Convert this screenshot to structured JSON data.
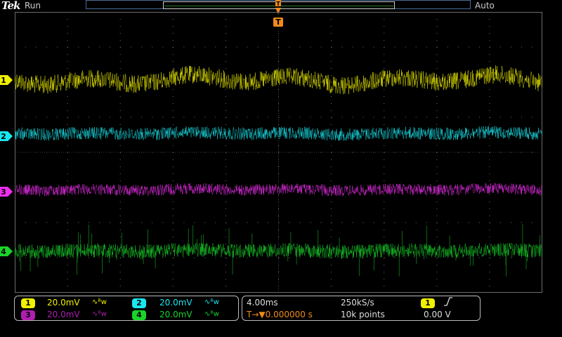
{
  "header": {
    "brand": "Tek",
    "acq_state": "Run",
    "trigger_mode": "Auto",
    "trigger_marker": "T"
  },
  "colors": {
    "ch1": "#f0f000",
    "ch2": "#19e6ef",
    "ch3": "#f02ef0",
    "ch4": "#19d42a",
    "trigger": "#f08a1c",
    "graticule": "#6b6b6b"
  },
  "channels": [
    {
      "id": "1",
      "scale": "20.0mV",
      "bw": "∿ᴮw",
      "color": "#f0f000"
    },
    {
      "id": "2",
      "scale": "20.0mV",
      "bw": "∿ᴮw",
      "color": "#19e6ef"
    },
    {
      "id": "3",
      "scale": "20.0mV",
      "bw": "∿ᴮw",
      "color": "#f02ef0"
    },
    {
      "id": "4",
      "scale": "20.0mV",
      "bw": "∿ᴮw",
      "color": "#19d42a"
    }
  ],
  "timebase": {
    "scale": "4.00ms",
    "sample_rate": "250kS/s",
    "trigger_position": "T→▼0.000000 s",
    "record_length": "10k points"
  },
  "trigger": {
    "source": "1",
    "slope": "⎍",
    "level": "0.00 V"
  }
}
